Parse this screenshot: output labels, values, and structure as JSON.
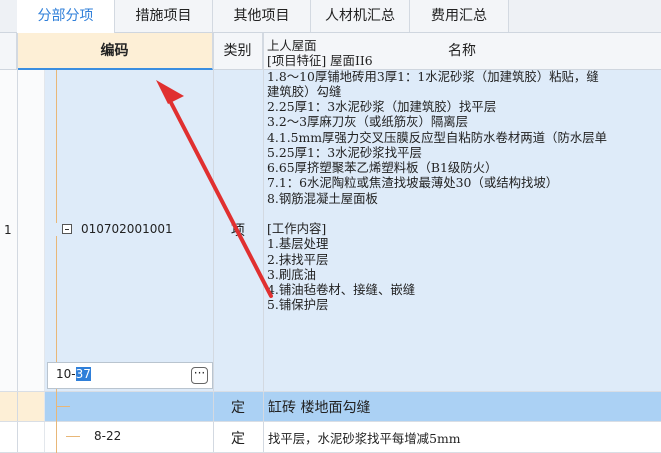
{
  "tabs": [
    "分部分项",
    "措施项目",
    "其他项目",
    "人材机汇总",
    "费用汇总"
  ],
  "columns": {
    "code": "编码",
    "category": "类别",
    "name": "名称"
  },
  "rows": [
    {
      "index": "1",
      "code": "010702001001",
      "category": "项",
      "description": [
        "上人屋面",
        "[项目特征]  屋面II6",
        "1.8～10厚铺地砖用3厚1：1水泥砂浆（加建筑胶）粘贴，缝",
        "建筑胶）勾缝",
        "2.25厚1：3水泥砂浆（加建筑胶）找平层",
        "3.2～3厚麻刀灰（或纸筋灰）隔离层",
        "4.1.5mm厚强力交叉压膜反应型自粘防水卷材两道（防水层单",
        "5.25厚1：3水泥砂浆找平层",
        "6.65厚挤塑聚苯乙烯塑料板（B1级防火）",
        "7.1：6水泥陶粒或焦渣找坡最薄处30（或结构找坡）",
        "8.钢筋混凝土屋面板",
        "",
        "[工作内容]",
        "1.基层处理",
        "2.抹找平层",
        "3.刷底油",
        "4.铺油毡卷材、接缝、嵌缝",
        "5.铺保护层"
      ]
    },
    {
      "code_prefix": "10-",
      "code_selected": "37",
      "category": "定",
      "name": "缸砖 楼地面勾缝"
    },
    {
      "code": "8-22",
      "category": "定",
      "name": "找平层，水泥砂浆找平每增减5mm"
    }
  ],
  "icons": {
    "expand": "minus-box-icon",
    "more": "ellipsis-icon",
    "annotation": "red-arrow-icon"
  },
  "colors": {
    "accent": "#2f7fd9",
    "code_header": "#fdefd6",
    "selected_row": "#abd1f4",
    "arrow": "#e03030"
  }
}
